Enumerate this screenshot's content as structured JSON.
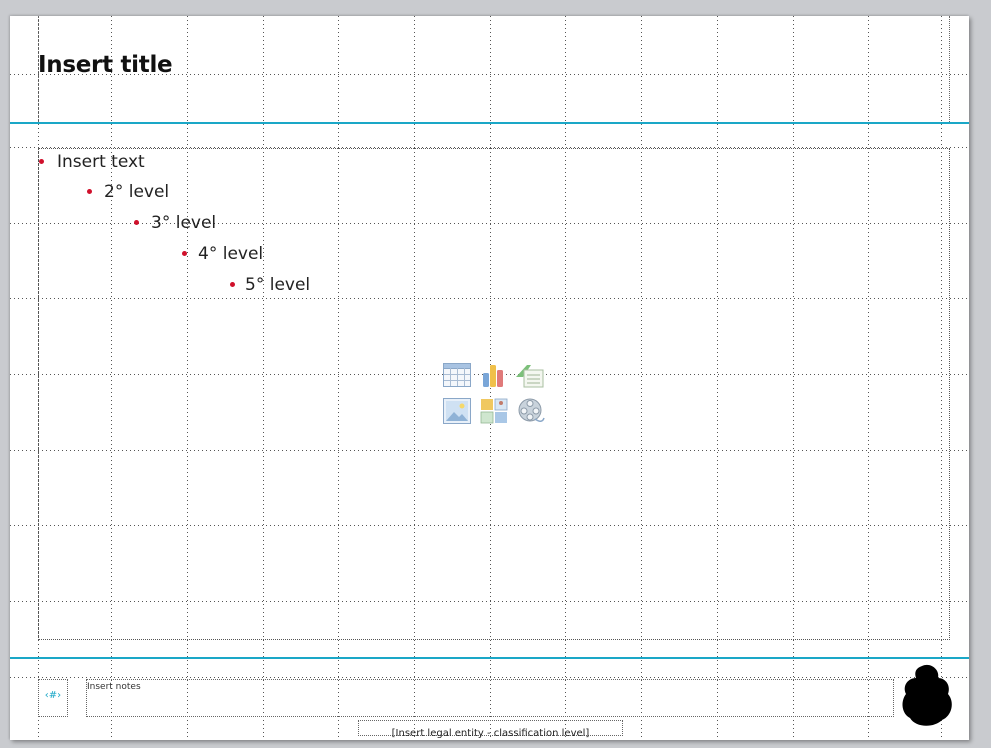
{
  "slide": {
    "title_placeholder": "Insert title",
    "body_levels": [
      {
        "text": "Insert text"
      },
      {
        "text": "2° level"
      },
      {
        "text": "3° level"
      },
      {
        "text": "4° level"
      },
      {
        "text": "5° level"
      }
    ],
    "slide_number_placeholder": "‹#›",
    "notes_placeholder": "Insert notes",
    "legal_placeholder": "[Insert legal entity - classification  level]"
  },
  "content_insert_icons": [
    {
      "icon": "insert-table-icon"
    },
    {
      "icon": "insert-chart-icon"
    },
    {
      "icon": "insert-smartart-icon"
    },
    {
      "icon": "insert-picture-icon"
    },
    {
      "icon": "insert-clipart-icon"
    },
    {
      "icon": "insert-media-icon"
    }
  ],
  "colors": {
    "accent_rule": "#1aa7c7",
    "bullet": "#d0102b",
    "background": "#c9cbcf"
  }
}
